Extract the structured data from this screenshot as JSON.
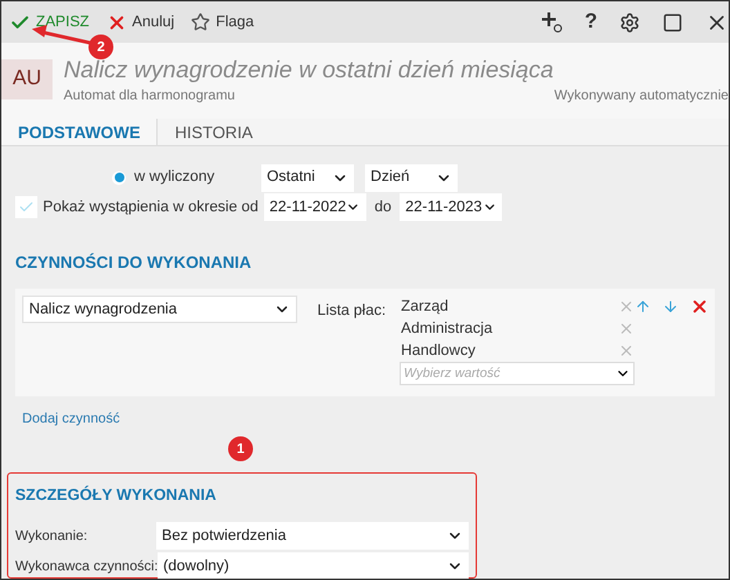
{
  "toolbar": {
    "buttons": [
      {
        "kind": "save",
        "label": "ZAPISZ"
      },
      {
        "kind": "cancel",
        "label": "Anuluj"
      },
      {
        "kind": "flag",
        "label": "Flaga"
      }
    ],
    "help_glyph": "?"
  },
  "header": {
    "badge": "AU",
    "title": "Nalicz wynagrodzenie w ostatni dzień miesiąca",
    "subtitle": "Automat dla harmonogramu",
    "status": "Wykonywany automatycznie"
  },
  "tabs": [
    {
      "label": "PODSTAWOWE",
      "selected": true
    },
    {
      "label": "HISTORIA",
      "selected": false
    }
  ],
  "schedule": {
    "radio": {
      "label": "w wyliczony",
      "selected": true
    },
    "which": "Ostatni",
    "unit": "Dzień",
    "show_range": {
      "label": "Pokaż wystąpienia w okresie od",
      "checked": true,
      "from": "22-11-2022",
      "to_label": "do",
      "to": "22-11-2023"
    }
  },
  "tasks": {
    "heading": "CZYNNOŚCI DO WYKONANIA",
    "action": "Nalicz wynagrodzenia",
    "list_label": "Lista płac:",
    "lists": [
      "Zarząd",
      "Administracja",
      "Handlowcy"
    ],
    "placeholder": "Wybierz wartość",
    "add_link": "Dodaj czynność"
  },
  "details": {
    "heading": "SZCZEGÓŁY WYKONANIA",
    "rows": [
      {
        "label": "Wykonanie:",
        "value": "Bez potwierdzenia"
      },
      {
        "label": "Wykonawca czynności:",
        "value": "(dowolny)"
      }
    ]
  },
  "annotations": [
    {
      "label": "1"
    },
    {
      "label": "2"
    }
  ]
}
